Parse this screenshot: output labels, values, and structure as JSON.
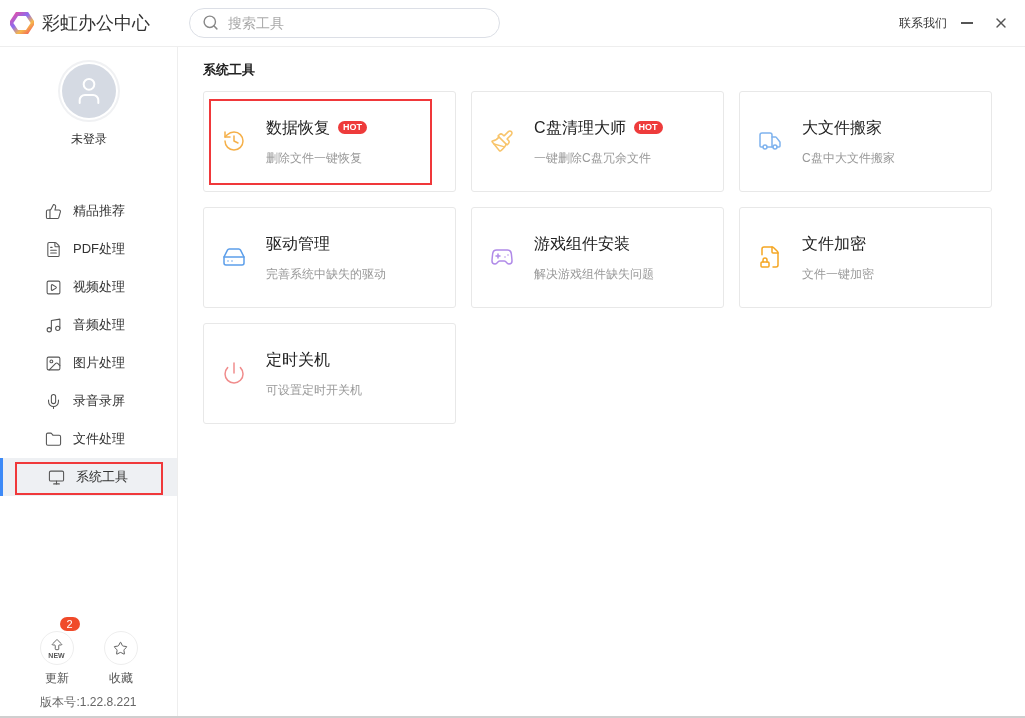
{
  "app": {
    "title": "彩虹办公中心",
    "search": {
      "placeholder": "搜索工具"
    },
    "contact": "联系我们"
  },
  "sidebar": {
    "user": {
      "name": "未登录"
    },
    "items": [
      {
        "label": "精品推荐",
        "selected": false,
        "highlighted": false
      },
      {
        "label": "PDF处理",
        "selected": false,
        "highlighted": false
      },
      {
        "label": "视频处理",
        "selected": false,
        "highlighted": false
      },
      {
        "label": "音频处理",
        "selected": false,
        "highlighted": false
      },
      {
        "label": "图片处理",
        "selected": false,
        "highlighted": false
      },
      {
        "label": "录音录屏",
        "selected": false,
        "highlighted": false
      },
      {
        "label": "文件处理",
        "selected": false,
        "highlighted": false
      },
      {
        "label": "系统工具",
        "selected": true,
        "highlighted": true
      }
    ],
    "update": {
      "label": "更新",
      "badge": "2",
      "icon_text": "NEW"
    },
    "favorites": {
      "label": "收藏"
    },
    "version": "版本号:1.22.8.221"
  },
  "section": {
    "title": "系统工具",
    "tools": [
      {
        "name": "数据恢复",
        "desc": "删除文件一键恢复",
        "badge": "HOT",
        "highlighted": true
      },
      {
        "name": "C盘清理大师",
        "desc": "一键删除C盘冗余文件",
        "badge": "HOT",
        "highlighted": false
      },
      {
        "name": "大文件搬家",
        "desc": "C盘中大文件搬家",
        "highlighted": false
      },
      {
        "name": "驱动管理",
        "desc": "完善系统中缺失的驱动",
        "highlighted": false
      },
      {
        "name": "游戏组件安装",
        "desc": "解决游戏组件缺失问题",
        "highlighted": false
      },
      {
        "name": "文件加密",
        "desc": "文件一键加密",
        "highlighted": false
      },
      {
        "name": "定时关机",
        "desc": "可设置定时开关机",
        "highlighted": false
      }
    ]
  }
}
